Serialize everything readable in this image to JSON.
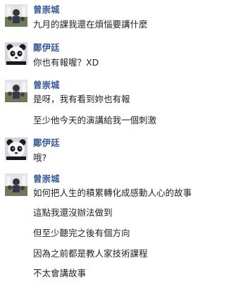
{
  "conversation": {
    "groups": [
      {
        "sender": "曾崇城",
        "avatar": "profile-photo-icon",
        "messages": [
          "九月的課我還在煩惱要講什麼"
        ]
      },
      {
        "sender": "鄭伊廷",
        "avatar": "panda-avatar-icon",
        "messages": [
          "你也有報喔？XD"
        ]
      },
      {
        "sender": "曾崇城",
        "avatar": "profile-photo-icon",
        "messages": [
          "是呀，我有看到妳也有報",
          "至少他今天的演講給我一個刺激"
        ]
      },
      {
        "sender": "鄭伊廷",
        "avatar": "panda-avatar-icon",
        "messages": [
          "哦?"
        ]
      },
      {
        "sender": "曾崇城",
        "avatar": "profile-photo-icon",
        "messages": [
          "如何把人生的積累轉化成感動人心的故事",
          "這點我還沒辦法做到",
          "但至少聽完之後有個方向",
          "因為之前都是教人家技術課程",
          "不太會講故事"
        ]
      }
    ]
  }
}
